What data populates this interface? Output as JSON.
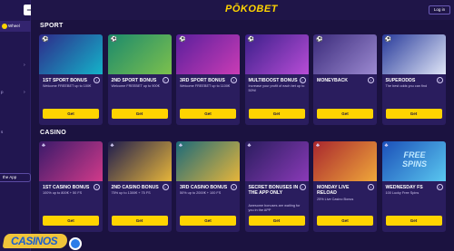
{
  "header": {
    "brand": "PŌKOBET",
    "login_label": "Log in"
  },
  "sidebar": {
    "collapse_label": "−",
    "wheel_label": "Wheel",
    "fragments": [
      "p",
      "s",
      "the App"
    ],
    "app_label": "the App"
  },
  "footer_logo": {
    "text": "CASINOS"
  },
  "sport": {
    "title": "SPORT",
    "cards": [
      {
        "title": "1ST SPORT BONUS",
        "desc": "Welcome FREEBET up to 100€",
        "cta": "Get",
        "art_colors": [
          "#2e2a8a",
          "#14b3c9"
        ]
      },
      {
        "title": "2ND SPORT BONUS",
        "desc": "Welcome FREEBET up to 900€",
        "cta": "Get",
        "art_colors": [
          "#1c8a6c",
          "#7cc04d"
        ]
      },
      {
        "title": "3RD SPORT BONUS",
        "desc": "Welcome FREEBET up to 1100€",
        "cta": "Get",
        "art_colors": [
          "#5a1f9c",
          "#c93cb5"
        ]
      },
      {
        "title": "MULTIBOOST BONUS",
        "desc": "Increase your profit of each bet up to 50%!",
        "cta": "Get",
        "art_colors": [
          "#3b1f8a",
          "#b84dd6"
        ]
      },
      {
        "title": "MONEYBACK",
        "desc": "",
        "cta": "Get",
        "art_colors": [
          "#3a2a7a",
          "#9c8ad1"
        ]
      },
      {
        "title": "SUPERODDS",
        "desc": "The best odds you can find",
        "cta": "Get",
        "art_colors": [
          "#283a9a",
          "#e0e6f7"
        ]
      }
    ]
  },
  "casino": {
    "title": "CASINO",
    "cards": [
      {
        "title": "1ST CASINO BONUS",
        "desc": "100% up to 800€ + 50 FS",
        "cta": "Get",
        "art_colors": [
          "#3a1a6a",
          "#d13a8a"
        ]
      },
      {
        "title": "2ND CASINO BONUS",
        "desc": "75% up to 1300€ + 75 FS",
        "cta": "Get",
        "art_colors": [
          "#1f1d4e",
          "#e6b53a"
        ]
      },
      {
        "title": "3RD CASINO BONUS",
        "desc": "50% up to 2000€ + 100 FS",
        "cta": "Get",
        "art_colors": [
          "#1b6a7a",
          "#e6b53a"
        ]
      },
      {
        "title": "SECRET BONUSES IN THE APP ONLY",
        "desc": "Awesome bonuses are waiting for you in the APP",
        "cta": "Get",
        "art_colors": [
          "#2a1d5e",
          "#8a3ab8"
        ]
      },
      {
        "title": "MONDAY LIVE RELOAD",
        "desc": "25% Live Casino Bonus",
        "cta": "Get",
        "art_colors": [
          "#a8262e",
          "#f0a83a"
        ]
      },
      {
        "title": "WEDNESDAY FS",
        "desc": "100 Lucky Free Spins",
        "cta": "Get",
        "art_colors": [
          "#1b4fb8",
          "#5ac8f0"
        ],
        "art_text": "FREE SPINS"
      }
    ]
  }
}
